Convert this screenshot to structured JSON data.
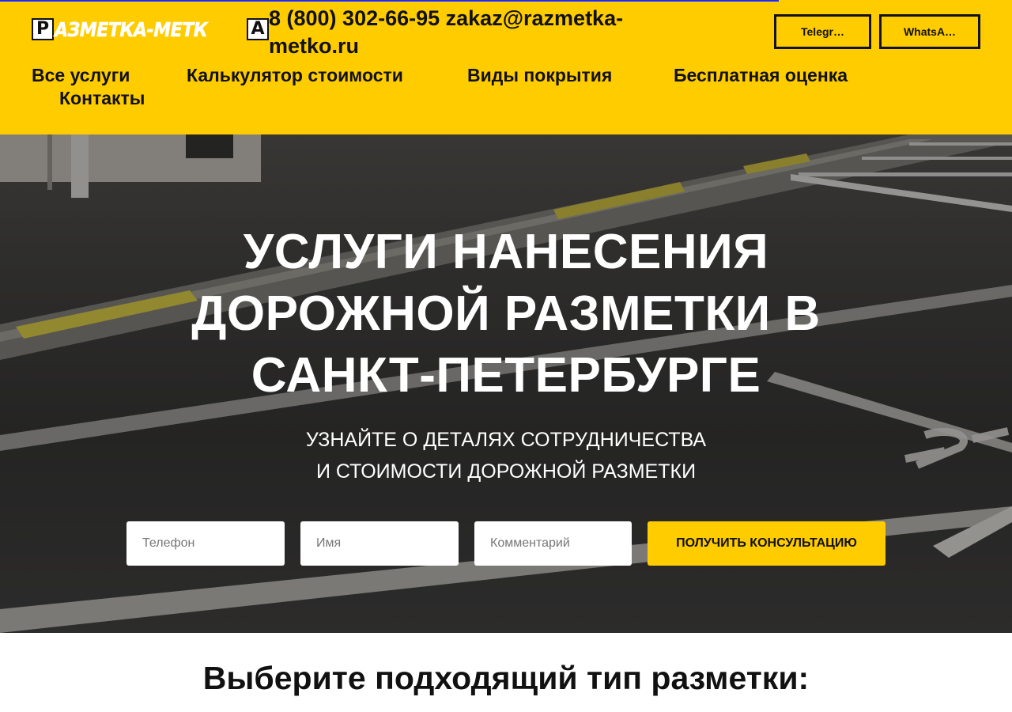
{
  "header": {
    "logo_left_letter": "P",
    "logo_text": "АЗМЕТКА-МЕТК",
    "logo_right_letter": "A",
    "contacts": "8 (800) 302-66-95 zakaz@razmetka-metko.ru",
    "telegram_label": "Telegr…",
    "whatsapp_label": "WhatsA…",
    "nav": [
      {
        "label": "Все услуги"
      },
      {
        "label": "Калькулятор стоимости"
      },
      {
        "label": "Виды покрытия"
      },
      {
        "label": "Бесплатная оценка"
      },
      {
        "label": "Контакты"
      }
    ]
  },
  "hero": {
    "title": "УСЛУГИ НАНЕСЕНИЯ ДОРОЖНОЙ РАЗМЕТКИ В САНКТ-ПЕТЕРБУРГЕ",
    "subtitle_line1": "УЗНАЙТЕ О ДЕТАЛЯХ СОТРУДНИЧЕСТВА",
    "subtitle_line2": "И СТОИМОСТИ ДОРОЖНОЙ РАЗМЕТКИ",
    "form": {
      "phone_placeholder": "Телефон",
      "name_placeholder": "Имя",
      "comment_placeholder": "Комментарий",
      "submit_label": "ПОЛУЧИТЬ КОНСУЛЬТАЦИЮ"
    }
  },
  "section": {
    "title": "Выберите подходящий тип разметки:"
  },
  "colors": {
    "brand_yellow": "#ffcc00",
    "text_dark": "#111111",
    "progress_blue": "#1d2bff"
  }
}
